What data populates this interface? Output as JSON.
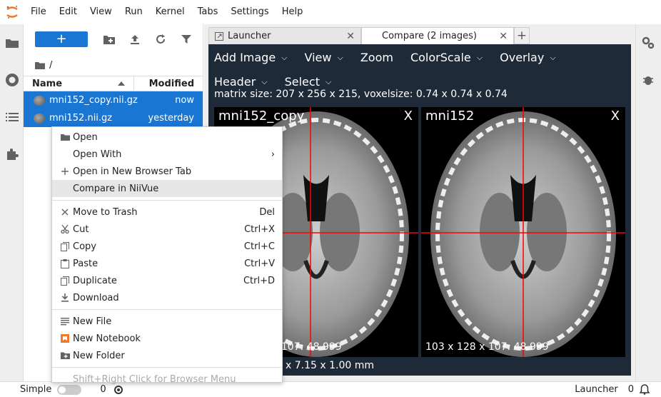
{
  "menubar": {
    "items": [
      "File",
      "Edit",
      "View",
      "Run",
      "Kernel",
      "Tabs",
      "Settings",
      "Help"
    ]
  },
  "file_browser": {
    "new_label": "+",
    "breadcrumb": "/",
    "header": {
      "name": "Name",
      "modified": "Modified"
    },
    "rows": [
      {
        "name": "mni152_copy.nii.gz",
        "modified": "now"
      },
      {
        "name": "mni152.nii.gz",
        "modified": "yesterday"
      }
    ]
  },
  "tabs": [
    {
      "label": "Launcher",
      "close": "✕"
    },
    {
      "label": "Compare (2 images)",
      "close": "✕"
    }
  ],
  "tab_add": "+",
  "viewer": {
    "menu": [
      "Add Image",
      "View",
      "Zoom",
      "ColorScale",
      "Overlay",
      "Header",
      "Select"
    ],
    "matrix_info": "matrix size: 207 x 256 x 215, voxelsize: 0.74 x 0.74 x 0.74",
    "panes": [
      {
        "title": "mni152_copy",
        "close": "X",
        "footer": "103 x 128 x 107: 48.999"
      },
      {
        "title": "mni152",
        "close": "X",
        "footer": "103 x 128 x 107: 48.999"
      }
    ],
    "bottom_info": "x 7.15 x 1.00 mm"
  },
  "context_menu": {
    "items": [
      {
        "label": "Open",
        "shortcut": "",
        "icon": "folder-icon"
      },
      {
        "label": "Open With",
        "shortcut": "›",
        "icon": ""
      },
      {
        "label": "Open in New Browser Tab",
        "shortcut": "",
        "icon": "plus-icon"
      },
      {
        "label": "Compare in NiiVue",
        "shortcut": "",
        "icon": ""
      },
      {
        "label": "Move to Trash",
        "shortcut": "Del",
        "icon": "close-icon"
      },
      {
        "label": "Cut",
        "shortcut": "Ctrl+X",
        "icon": "scissors-icon"
      },
      {
        "label": "Copy",
        "shortcut": "Ctrl+C",
        "icon": "copy-icon"
      },
      {
        "label": "Paste",
        "shortcut": "Ctrl+V",
        "icon": "paste-icon"
      },
      {
        "label": "Duplicate",
        "shortcut": "Ctrl+D",
        "icon": "duplicate-icon"
      },
      {
        "label": "Download",
        "shortcut": "",
        "icon": "download-icon"
      },
      {
        "label": "New File",
        "shortcut": "",
        "icon": "file-icon"
      },
      {
        "label": "New Notebook",
        "shortcut": "",
        "icon": "notebook-icon"
      },
      {
        "label": "New Folder",
        "shortcut": "",
        "icon": "new-folder-icon"
      },
      {
        "label": "Shift+Right Click for Browser Menu",
        "shortcut": "",
        "icon": ""
      }
    ]
  },
  "statusbar": {
    "mode_label": "Simple",
    "kernels_count": "0",
    "launcher_label": "Launcher",
    "notifications_count": "0"
  },
  "colors": {
    "accent": "#1976d2",
    "viewer_bg": "#1f2a38",
    "crosshair": "#ff0000",
    "notebook": "#f37726"
  }
}
